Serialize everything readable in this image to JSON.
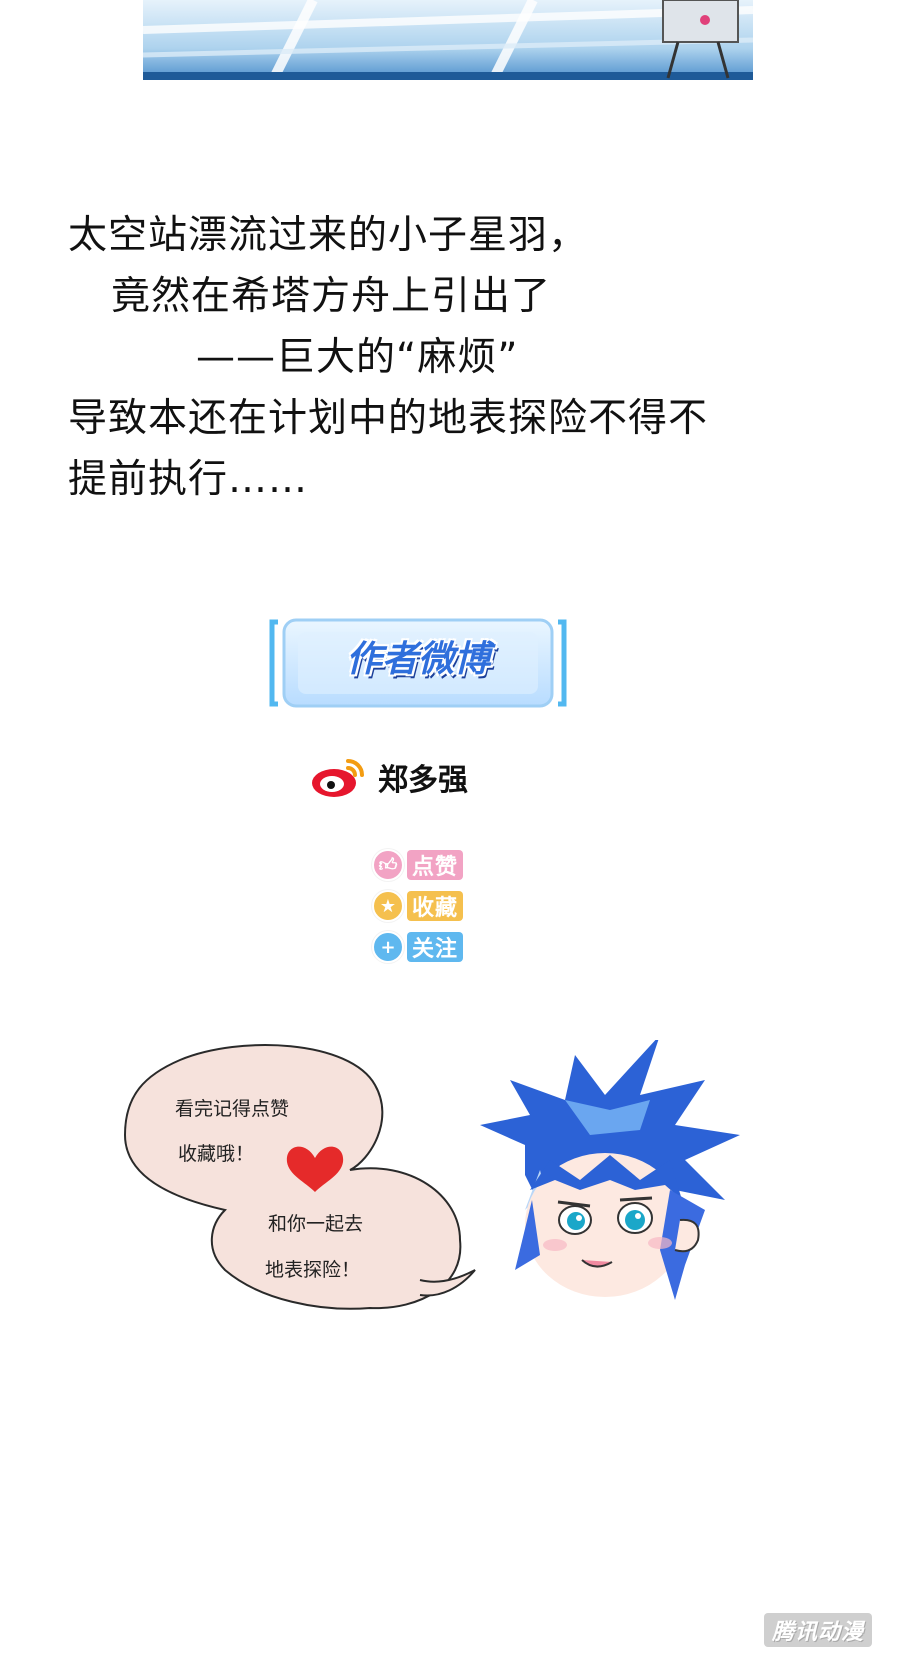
{
  "story": {
    "lines": [
      "太空站漂流过来的小子星羽，",
      "竟然在希塔方舟上引出了",
      "——巨大的“麻烦”",
      "导致本还在计划中的地表探险不得不",
      "提前执行……"
    ]
  },
  "author_section": {
    "banner_label": "作者微博",
    "weibo_icon": "weibo-icon",
    "author_name": "郑多强"
  },
  "actions": [
    {
      "label": "点赞",
      "icon": "thumbs-up-icon",
      "color": "#f2a3c4"
    },
    {
      "label": "收藏",
      "icon": "star-icon",
      "color": "#f5c04e"
    },
    {
      "label": "关注",
      "icon": "plus-icon",
      "color": "#5fb8ef"
    }
  ],
  "bubble": {
    "line1": "看完记得点赞",
    "line2": "收藏哦！",
    "line3": "和你一起去",
    "line4": "地表探险！"
  },
  "watermark": "腾讯动漫",
  "colors": {
    "banner_blue": "#2f6fdc",
    "bubble_fill": "#f6e2dc",
    "hair_blue": "#2c62d6",
    "heart_red": "#e52a2a"
  }
}
